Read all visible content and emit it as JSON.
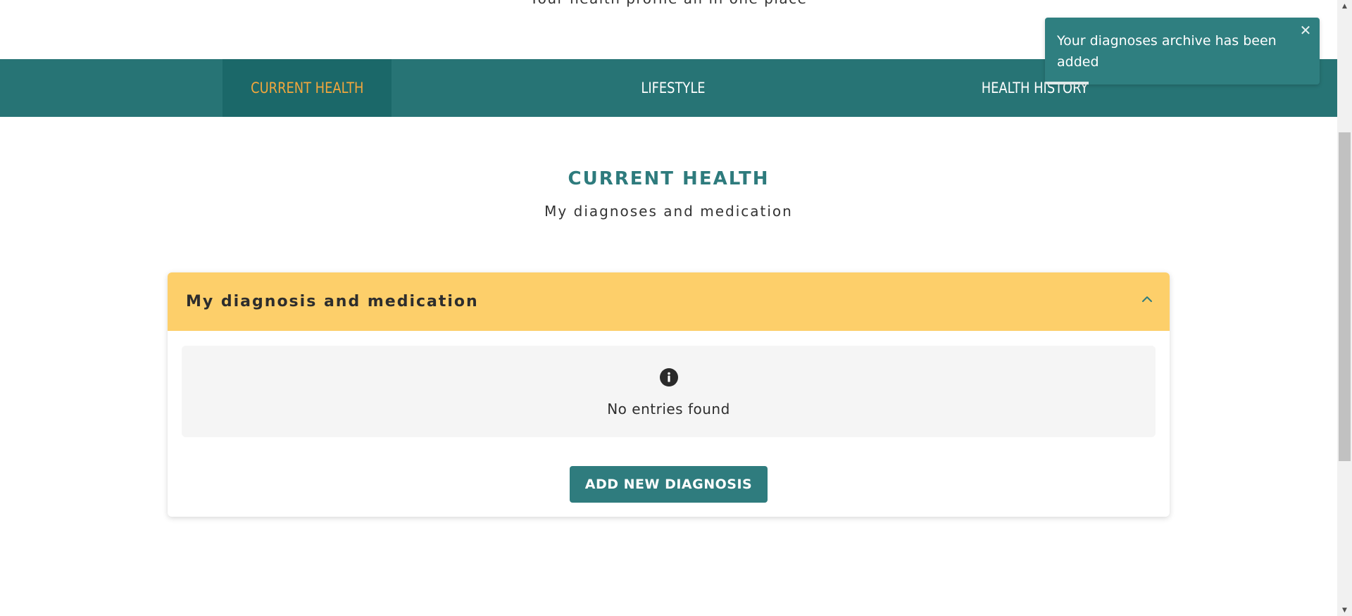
{
  "top": {
    "subtitle": "Your health profile all in one place"
  },
  "tabs": [
    {
      "label": "CURRENT HEALTH",
      "active": true
    },
    {
      "label": "LIFESTYLE",
      "active": false
    },
    {
      "label": "HEALTH HISTORY",
      "active": false
    }
  ],
  "section": {
    "title": "CURRENT HEALTH",
    "subtitle": "My diagnoses and medication"
  },
  "card": {
    "header_title": "My diagnosis and medication",
    "empty_icon": "info-icon",
    "empty_text": "No entries found",
    "add_button_label": "ADD NEW DIAGNOSIS"
  },
  "toast": {
    "message": "Your diagnoses archive has been added",
    "close_symbol": "✕",
    "progress_fraction": 0.16
  },
  "colors": {
    "tabbar": "#277475",
    "active_tab_bg": "#1b6869",
    "active_tab_text": "#f3a73c",
    "card_header": "#fdcf6a",
    "primary_button": "#2f7c7e",
    "section_title": "#2e7b7d",
    "toast_bg": "#2f7f80"
  }
}
